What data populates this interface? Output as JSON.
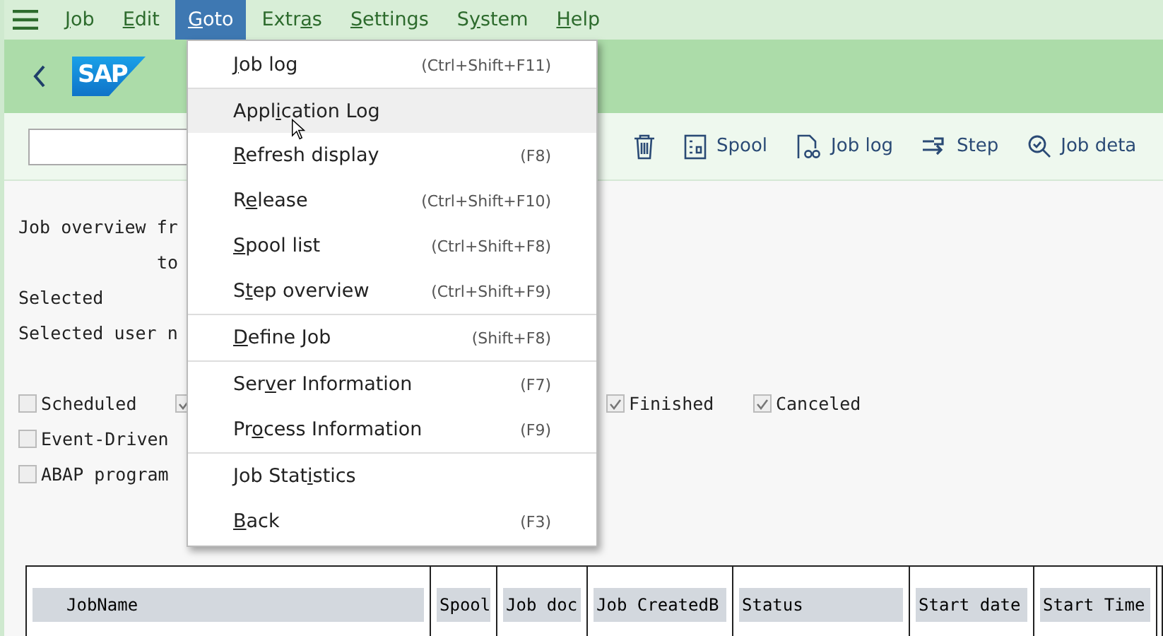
{
  "menubar": [
    {
      "parts": {
        "key": "J",
        "post": "ob"
      },
      "selected": false
    },
    {
      "parts": {
        "key": "E",
        "post": "dit"
      },
      "selected": false
    },
    {
      "parts": {
        "key": "G",
        "post": "oto"
      },
      "selected": true
    },
    {
      "parts": {
        "pre": "Extr",
        "key": "a",
        "post": "s"
      },
      "selected": false
    },
    {
      "parts": {
        "key": "S",
        "post": "ettings"
      },
      "selected": false
    },
    {
      "parts": {
        "pre": "S",
        "key": "y",
        "post": "stem"
      },
      "selected": false
    },
    {
      "parts": {
        "key": "H",
        "post": "elp"
      },
      "selected": false
    }
  ],
  "logo": "SAP",
  "toolbar": [
    {
      "kind": "field"
    },
    {
      "kind": "delete"
    },
    {
      "kind": "spool",
      "label": "Spool"
    },
    {
      "kind": "joblog",
      "label": "Job log"
    },
    {
      "kind": "step",
      "label": "Step"
    },
    {
      "kind": "details",
      "label": "Job deta"
    }
  ],
  "overview": {
    "lines": [
      {
        "text": "Job overview fr",
        "indent": false
      },
      {
        "text": "to",
        "indent": true
      },
      {
        "text": "Selected",
        "indent": false
      },
      {
        "text": "Selected user n",
        "indent": false
      }
    ],
    "status_rows": [
      [
        {
          "label": "Scheduled",
          "checked": false
        },
        {
          "checked": true
        },
        {
          "label": "Finished",
          "checked": true
        },
        {
          "label": "Canceled",
          "checked": true
        }
      ],
      [
        {
          "label": "Event-Driven",
          "checked": false
        }
      ],
      [
        {
          "label": "ABAP program",
          "checked": false
        }
      ]
    ]
  },
  "table": {
    "columns": [
      "JobName",
      "Spool",
      "Job doc",
      "Job CreatedB",
      "Status",
      "Start date",
      "Start Time"
    ]
  },
  "goto_menu": [
    [
      {
        "parts": {
          "key": "J",
          "post": "ob log"
        },
        "shortcut": "(Ctrl+Shift+F11)",
        "selected": false
      },
      {
        "parts": {
          "pre": "Appl",
          "key": "i",
          "post": "cation Log"
        },
        "selected": true
      },
      {
        "parts": {
          "key": "R",
          "post": "efresh display"
        },
        "shortcut": "(F8)",
        "selected": false
      },
      {
        "parts": {
          "pre": "R",
          "key": "e",
          "post": "lease"
        },
        "shortcut": "(Ctrl+Shift+F10)",
        "selected": false
      },
      {
        "parts": {
          "key": "S",
          "post": "pool list"
        },
        "shortcut": "(Ctrl+Shift+F8)",
        "selected": false
      },
      {
        "parts": {
          "pre": "S",
          "key": "t",
          "post": "ep overview"
        },
        "shortcut": "(Ctrl+Shift+F9)",
        "selected": false
      }
    ],
    [
      {
        "parts": {
          "key": "D",
          "post": "efine Job"
        },
        "shortcut": "(Shift+F8)",
        "selected": false
      }
    ],
    [
      {
        "parts": {
          "pre": "Ser",
          "key": "v",
          "post": "er Information"
        },
        "shortcut": "(F7)",
        "selected": false
      },
      {
        "parts": {
          "pre": "Pr",
          "key": "o",
          "post": "cess Information"
        },
        "shortcut": "(F9)",
        "selected": false
      }
    ],
    [
      {
        "parts": {
          "pre": "Job Stat",
          "key": "i",
          "post": "stics"
        },
        "selected": false
      },
      {
        "parts": {
          "key": "B",
          "post": "ack"
        },
        "shortcut": "(F3)",
        "selected": false
      }
    ]
  ]
}
